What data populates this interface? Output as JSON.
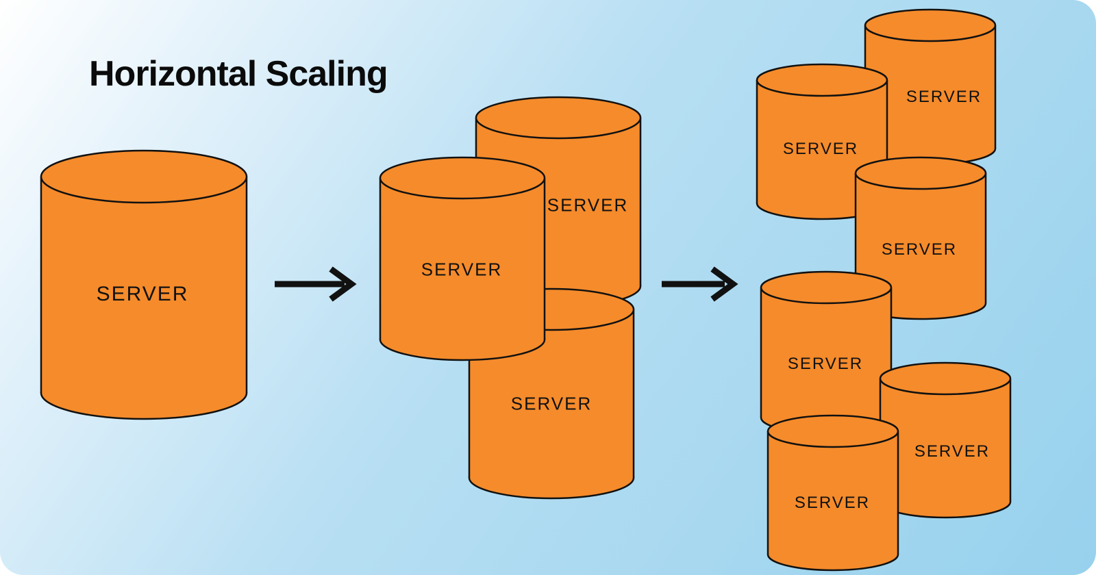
{
  "title": "Horizontal Scaling",
  "server_label": "SERVER",
  "colors": {
    "cylinder_fill": "#f58b2b",
    "cylinder_stroke": "#111111",
    "arrow": "#111111",
    "bg_light": "#ffffff",
    "bg_dark": "#97d1ed"
  },
  "diagram": {
    "description": "Single server scales out to 3 servers then to 6 servers",
    "stages": [
      {
        "count": 1
      },
      {
        "count": 3
      },
      {
        "count": 6
      }
    ]
  },
  "stage1": {
    "s1": "SERVER"
  },
  "stage2": {
    "s1": "SERVER",
    "s2": "SERVER",
    "s3": "SERVER"
  },
  "stage3": {
    "s1": "SERVER",
    "s2": "SERVER",
    "s3": "SERVER",
    "s4": "SERVER",
    "s5": "SERVER",
    "s6": "SERVER"
  }
}
